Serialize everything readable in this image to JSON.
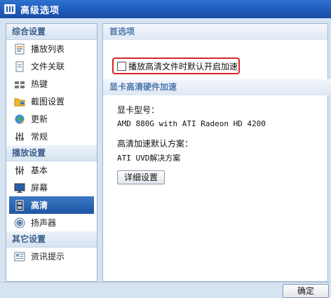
{
  "window": {
    "title": "高级选项",
    "icon": "app-logo-icon"
  },
  "sidebar": {
    "sections": [
      {
        "title": "综合设置",
        "items": [
          {
            "label": "播放列表",
            "icon": "playlist-icon"
          },
          {
            "label": "文件关联",
            "icon": "file-association-icon"
          },
          {
            "label": "热键",
            "icon": "keyboard-icon"
          },
          {
            "label": "截图设置",
            "icon": "screenshot-folder-icon"
          },
          {
            "label": "更新",
            "icon": "update-globe-icon"
          },
          {
            "label": "常规",
            "icon": "general-settings-icon"
          }
        ]
      },
      {
        "title": "播放设置",
        "items": [
          {
            "label": "基本",
            "icon": "basic-settings-icon"
          },
          {
            "label": "屏幕",
            "icon": "monitor-icon"
          },
          {
            "label": "高清",
            "icon": "hd-film-icon",
            "selected": true
          },
          {
            "label": "扬声器",
            "icon": "speaker-icon"
          }
        ]
      },
      {
        "title": "其它设置",
        "items": [
          {
            "label": "资讯提示",
            "icon": "news-icon"
          }
        ]
      }
    ]
  },
  "main": {
    "preferences_header": "首选项",
    "hd_default_checkbox": {
      "label": "播放高清文件时默认开启加速",
      "checked": false
    },
    "hw_accel_header": "显卡高清硬件加速",
    "gpu_model_label": "显卡型号：",
    "gpu_model_value": "AMD 880G with ATI Radeon HD 4200",
    "accel_scheme_label": "高清加速默认方案：",
    "accel_scheme_value": "ATI UVD解决方案",
    "details_button": "详细设置"
  },
  "footer": {
    "ok_button": "确定"
  },
  "colors": {
    "titlebar": "#1f5bb8",
    "selection": "#2b64b0",
    "highlight_border": "#d9232a"
  }
}
